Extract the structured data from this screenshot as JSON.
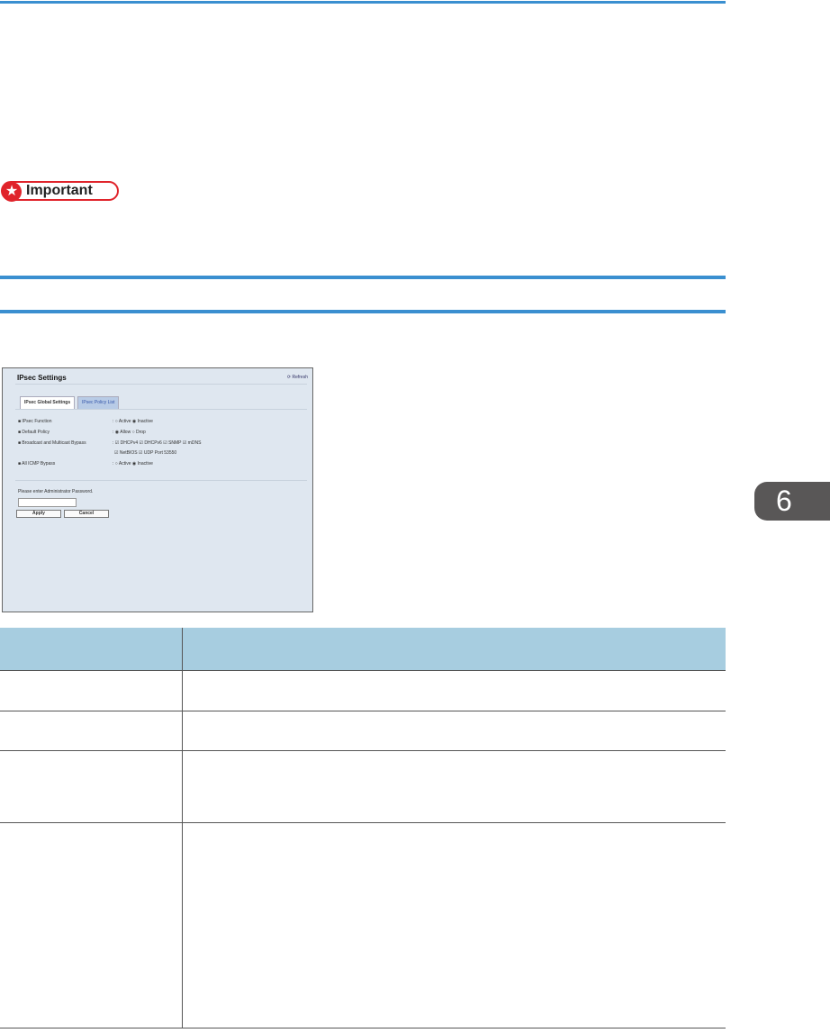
{
  "important": {
    "label": "Important"
  },
  "screenshot": {
    "title": "IPsec Settings",
    "refresh": "Refresh",
    "tabs": [
      "IPsec Global Settings",
      "IPsec Policy List"
    ],
    "rows": [
      {
        "label": "IPsec Function",
        "value": ": ○ Active ◉ Inactive"
      },
      {
        "label": "Default Policy",
        "value": ": ◉ Allow ○ Drop"
      },
      {
        "label": "Broadcast and Multicast Bypass",
        "value": ": ☑ DHCPv4 ☑ DHCPv6 ☑ SNMP ☑ mDNS"
      },
      {
        "label": "",
        "value": "☑ NetBIOS ☑ UDP Port 53550"
      },
      {
        "label": "All ICMP Bypass",
        "value": ": ○ Active ◉ Inactive"
      }
    ],
    "password_label": "Please enter Administrator Password.",
    "apply": "Apply",
    "cancel": "Cancel"
  },
  "chapter_tab": "6"
}
